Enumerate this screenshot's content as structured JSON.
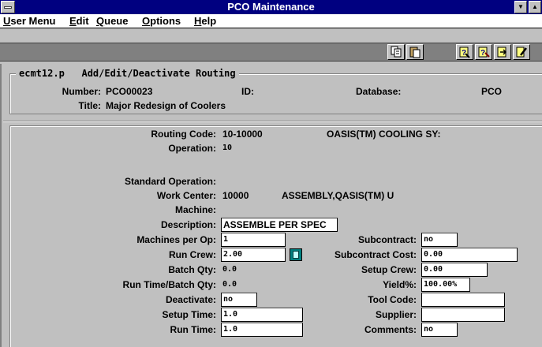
{
  "window": {
    "title": "PCO Maintenance"
  },
  "menu": {
    "user_menu": "User Menu",
    "edit": "Edit",
    "queue": "Queue",
    "options": "Options",
    "help": "Help"
  },
  "toolbar": {
    "icons": [
      "copy-icon",
      "paste-icon",
      "query-icon",
      "query-edit-icon",
      "query-next-icon",
      "edit-pen-icon"
    ]
  },
  "header": {
    "program": "ecmt12.p",
    "screen_title": "Add/Edit/Deactivate Routing",
    "number_label": "Number:",
    "number_value": "PCO00023",
    "id_label": "ID:",
    "database_label": "Database:",
    "database_value": "PCO",
    "title_label": "Title:",
    "title_value": "Major Redesign of Coolers"
  },
  "routing": {
    "routing_code_label": "Routing Code:",
    "routing_code_value": "10-10000",
    "routing_desc": "OASIS(TM) COOLING SY:",
    "operation_label": "Operation:",
    "operation_value": "10",
    "standard_operation_label": "Standard Operation:",
    "work_center_label": "Work Center:",
    "work_center_value": "10000",
    "work_center_desc": "ASSEMBLY,QASIS(TM) U",
    "machine_label": "Machine:",
    "description_label": "Description:",
    "description_value": "ASSEMBLE PER SPEC",
    "machines_per_op_label": "Machines per Op:",
    "machines_per_op_value": "1",
    "run_crew_label": "Run Crew:",
    "run_crew_value": "2.00",
    "batch_qty_label": "Batch Qty:",
    "batch_qty_value": "0.0",
    "run_time_batch_label": "Run Time/Batch Qty:",
    "run_time_batch_value": "0.0",
    "deactivate_label": "Deactivate:",
    "deactivate_value": "no",
    "setup_time_label": "Setup Time:",
    "setup_time_value": "1.0",
    "run_time_label": "Run Time:",
    "run_time_value": "1.0",
    "subcontract_label": "Subcontract:",
    "subcontract_value": "no",
    "subcontract_cost_label": "Subcontract Cost:",
    "subcontract_cost_value": "0.00",
    "setup_crew_label": "Setup Crew:",
    "setup_crew_value": "0.00",
    "yield_label": "Yield%:",
    "yield_value": "100.00%",
    "tool_code_label": "Tool Code:",
    "tool_code_value": "",
    "supplier_label": "Supplier:",
    "supplier_value": "",
    "comments_label": "Comments:",
    "comments_value": "no"
  }
}
